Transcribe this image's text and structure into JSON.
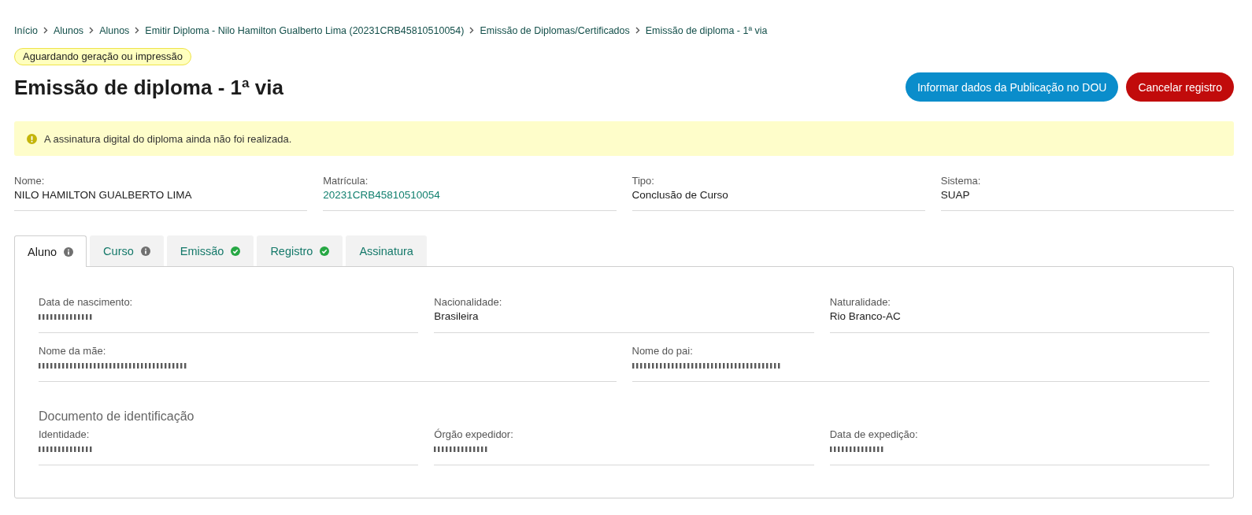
{
  "breadcrumb": [
    {
      "label": "Início"
    },
    {
      "label": "Alunos"
    },
    {
      "label": "Alunos"
    },
    {
      "label": "Emitir Diploma - Nilo Hamilton Gualberto Lima (20231CRB45810510054)"
    },
    {
      "label": "Emissão de Diplomas/Certificados"
    },
    {
      "label": "Emissão de diploma - 1ª via"
    }
  ],
  "status_badge": "Aguardando geração ou impressão",
  "title": "Emissão de diploma - 1ª via",
  "actions": [
    {
      "label": "Informar dados da Publicação no DOU",
      "kind": "primary"
    },
    {
      "label": "Cancelar registro",
      "kind": "danger"
    }
  ],
  "alert": {
    "kind": "warning",
    "text": "A assinatura digital do diploma ainda não foi realizada."
  },
  "summary": [
    {
      "label": "Nome:",
      "value": "NILO HAMILTON GUALBERTO LIMA",
      "link": false
    },
    {
      "label": "Matrícula:",
      "value": "20231CRB45810510054",
      "link": true
    },
    {
      "label": "Tipo:",
      "value": "Conclusão de Curso",
      "link": false
    },
    {
      "label": "Sistema:",
      "value": "SUAP",
      "link": false
    }
  ],
  "tabs": [
    {
      "label": "Aluno",
      "selected": true,
      "kind": "info"
    },
    {
      "label": "Curso",
      "selected": false,
      "kind": "info"
    },
    {
      "label": "Emissão",
      "selected": false,
      "kind": "done"
    },
    {
      "label": "Registro",
      "selected": false,
      "kind": "done"
    },
    {
      "label": "Assinatura",
      "selected": false,
      "kind": "plain"
    }
  ],
  "tab_panel": {
    "groups": [
      {
        "rows": [
          {
            "fields": [
              {
                "label": "Data de nascimento:",
                "redacted": true
              },
              {
                "label": "Nacionalidade:",
                "value": "Brasileira",
                "redacted": false
              },
              {
                "label": "Naturalidade:",
                "value": "Rio Branco-AC",
                "redacted": false
              }
            ]
          },
          {
            "fields": [
              {
                "label": "Nome da mãe:",
                "redacted": true
              },
              {
                "label": "Nome do pai:",
                "redacted": true
              }
            ]
          }
        ]
      },
      {
        "heading": "Documento de identificação",
        "rows": [
          {
            "fields": [
              {
                "label": "Identidade:",
                "redacted": true
              },
              {
                "label": "Órgão expedidor:",
                "redacted": true
              },
              {
                "label": "Data de expedição:",
                "redacted": true
              }
            ]
          }
        ]
      }
    ]
  }
}
